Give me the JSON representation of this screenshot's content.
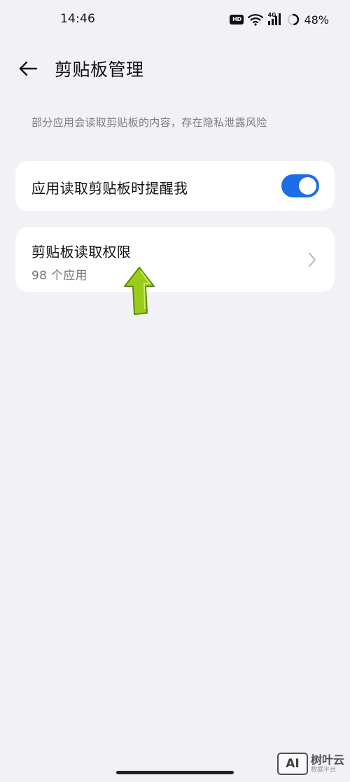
{
  "status_bar": {
    "time": "14:46",
    "hd_label": "HD",
    "network_label": "4G",
    "battery": "48%"
  },
  "app_bar": {
    "title": "剪贴板管理"
  },
  "description": "部分应用会读取剪贴板的内容，存在隐私泄露风险",
  "toggle_item": {
    "label": "应用读取剪贴板时提醒我",
    "enabled": true,
    "accent_color": "#1d6de8"
  },
  "permission_item": {
    "title": "剪贴板读取权限",
    "subtitle": "98 个应用"
  },
  "watermark": {
    "logo": "AI",
    "name": "树叶云",
    "sub": "数据平台"
  },
  "colors": {
    "background": "#f2f2f6",
    "card": "#ffffff",
    "arrow": "#9ccc1a"
  }
}
